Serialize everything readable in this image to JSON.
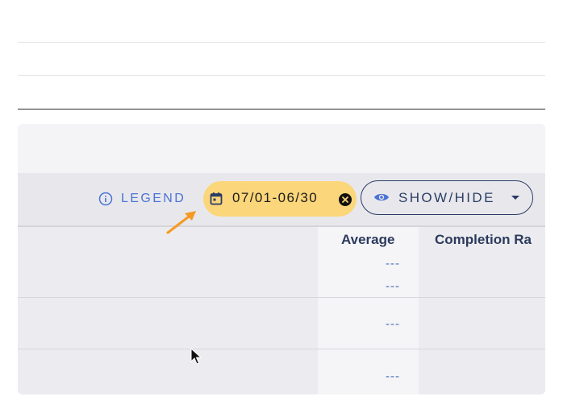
{
  "toolbar": {
    "legend_label": "LEGEND",
    "date_range": "07/01-06/30",
    "show_hide_label": "SHOW/HIDE"
  },
  "table": {
    "columns": [
      "Average",
      "Completion Ra"
    ],
    "rows": [
      {
        "average": [
          "---",
          "---"
        ]
      },
      {
        "average": [
          "---"
        ]
      },
      {
        "average": [
          "---"
        ]
      }
    ]
  },
  "colors": {
    "accent": "#4a73d6",
    "chip": "#fbd67a",
    "annotation_arrow": "#f59a23"
  },
  "icons": [
    "info-icon",
    "calendar-icon",
    "clear-icon",
    "eye-icon",
    "caret-down-icon",
    "annotation-arrow",
    "mouse-cursor"
  ]
}
